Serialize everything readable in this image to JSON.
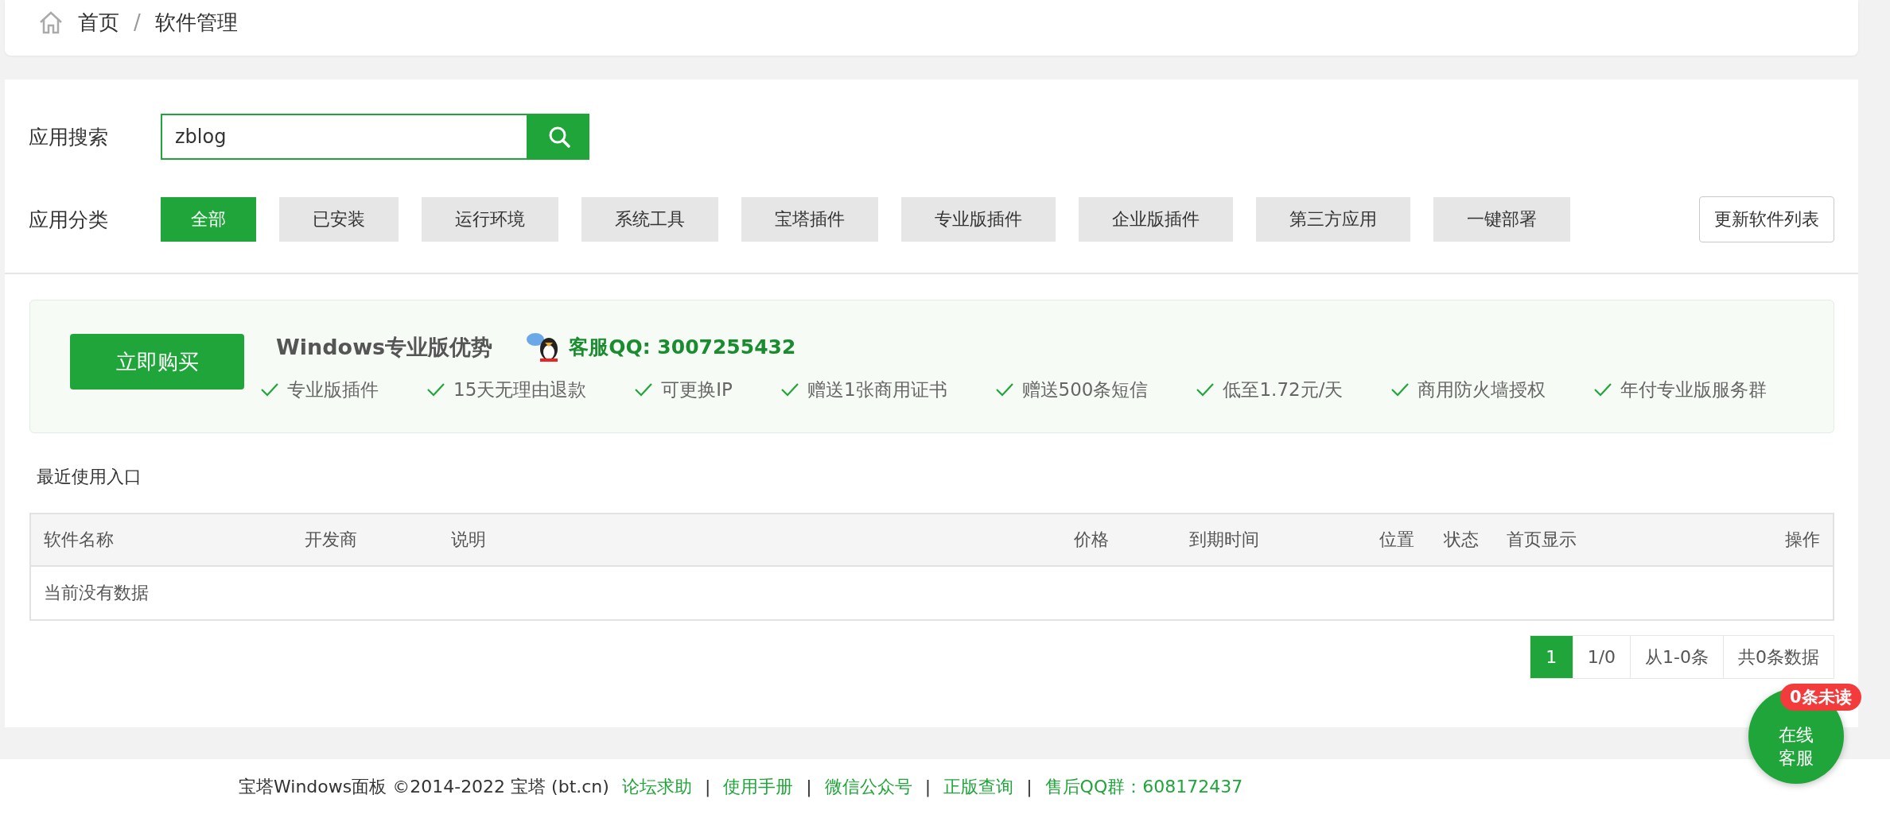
{
  "breadcrumb": [
    "首页",
    "/",
    "软件管理"
  ],
  "search": {
    "label": "应用搜索",
    "value": "zblog"
  },
  "categories": {
    "label": "应用分类",
    "items": [
      {
        "label": "全部",
        "selected": true
      },
      {
        "label": "已安装",
        "selected": false
      },
      {
        "label": "运行环境",
        "selected": false
      },
      {
        "label": "系统工具",
        "selected": false
      },
      {
        "label": "宝塔插件",
        "selected": false
      },
      {
        "label": "专业版插件",
        "selected": false
      },
      {
        "label": "企业版插件",
        "selected": false
      },
      {
        "label": "第三方应用",
        "selected": false
      },
      {
        "label": "一键部署",
        "selected": false
      }
    ],
    "refresh_button": "更新软件列表"
  },
  "promo": {
    "buy_button": "立即购买",
    "title": "Windows专业版优势",
    "contact": "客服QQ: 3007255432",
    "features": [
      "专业版插件",
      "15天无理由退款",
      "可更换IP",
      "赠送1张商用证书",
      "赠送500条短信",
      "低至1.72元/天",
      "商用防火墙授权",
      "年付专业版服务群"
    ]
  },
  "recent_label": "最近使用入口",
  "table": {
    "columns": [
      "软件名称",
      "开发商",
      "说明",
      "价格",
      "到期时间",
      "位置",
      "状态",
      "首页显示",
      "操作"
    ],
    "empty": "当前没有数据"
  },
  "pagination": {
    "pages": [
      {
        "label": "1",
        "selected": true
      }
    ],
    "page_info": "1/0",
    "range": "从1-0条",
    "total": "共0条数据"
  },
  "chat": {
    "badge": "0条未读",
    "label": "在线客服"
  },
  "footer": {
    "copyright": "宝塔Windows面板 ©2014-2022 宝塔 (bt.cn)",
    "links": [
      "论坛求助",
      "使用手册",
      "微信公众号",
      "正版查询",
      "售后QQ群：608172437"
    ],
    "separator": "|"
  }
}
